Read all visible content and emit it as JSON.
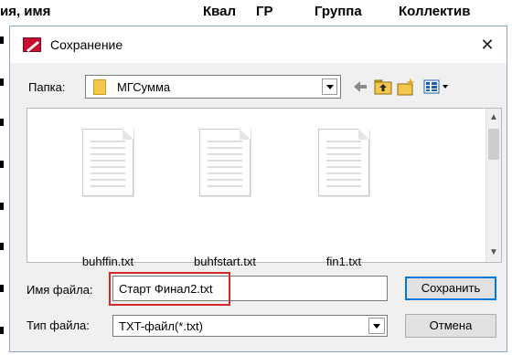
{
  "background_table": {
    "headers": [
      "ия, имя",
      "Квал",
      "ГР",
      "Группа",
      "Коллектив"
    ]
  },
  "dialog": {
    "title": "Сохранение",
    "folder_label": "Папка:",
    "folder_value": "МГСумма",
    "toolbar": {
      "back_icon": "back-arrow-icon",
      "up_icon": "up-folder-icon",
      "new_folder_icon": "new-folder-icon",
      "view_icon": "view-menu-icon"
    },
    "files": [
      {
        "name": "buhffin.txt"
      },
      {
        "name": "buhfstart.txt"
      },
      {
        "name": "fin1.txt"
      }
    ],
    "filename_label": "Имя файла:",
    "filename_value": "Старт Финал2.txt",
    "filetype_label": "Тип файла:",
    "filetype_value": "TXT-файл(*.txt)",
    "save_label": "Сохранить",
    "cancel_label": "Отмена",
    "close_glyph": "✕"
  },
  "colors": {
    "highlight": "#d22a2a",
    "accent": "#0078d7",
    "folder": "#f4c84a"
  }
}
